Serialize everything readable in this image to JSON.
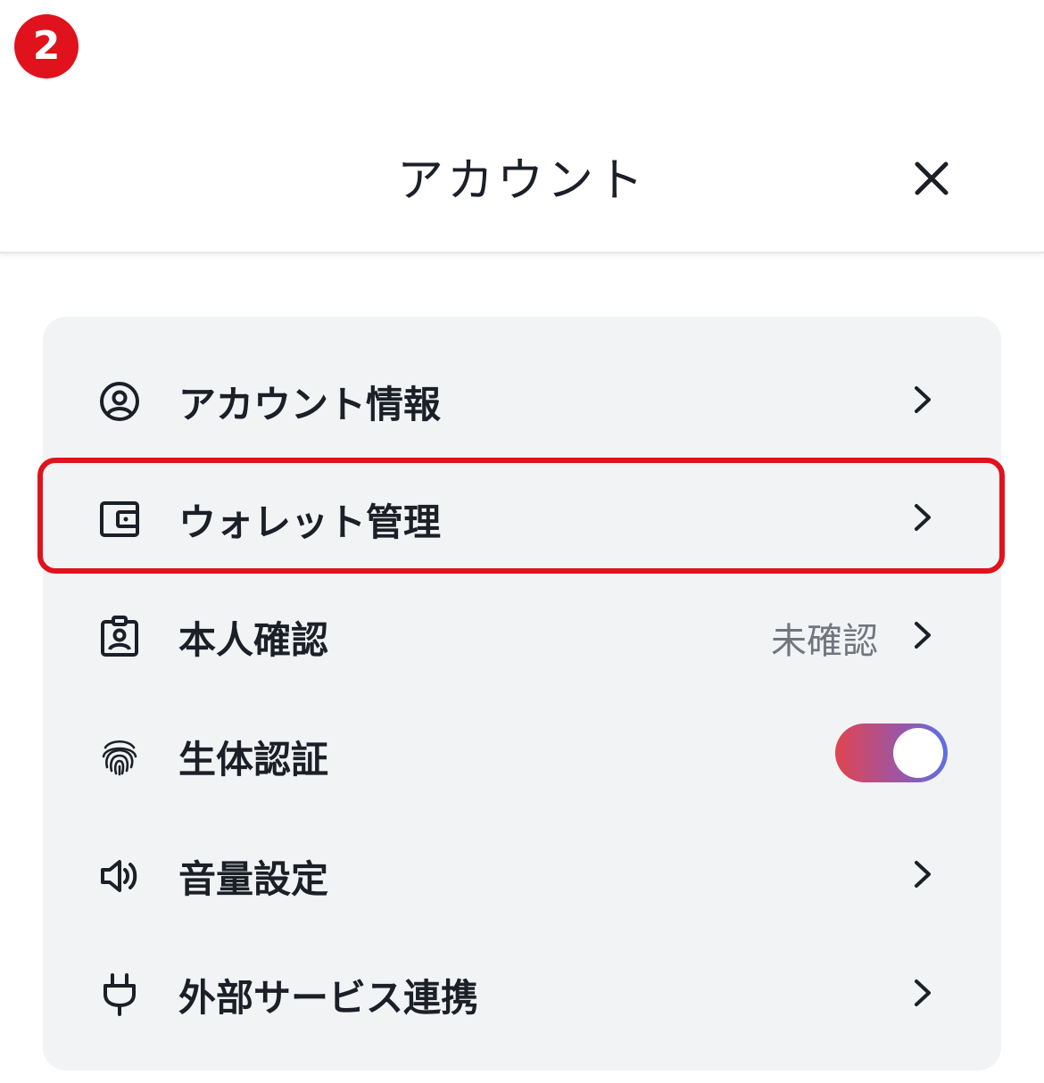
{
  "step_badge": "2",
  "header": {
    "title": "アカウント",
    "close_icon": "close-icon"
  },
  "menu": {
    "items": [
      {
        "label": "アカウント情報",
        "icon": "user-circle-icon"
      },
      {
        "label": "ウォレット管理",
        "icon": "wallet-icon",
        "highlighted": true
      },
      {
        "label": "本人確認",
        "icon": "id-badge-icon",
        "status": "未確認"
      },
      {
        "label": "生体認証",
        "icon": "fingerprint-icon",
        "toggle_on": true
      },
      {
        "label": "音量設定",
        "icon": "speaker-icon"
      },
      {
        "label": "外部サービス連携",
        "icon": "plug-icon"
      }
    ]
  },
  "colors": {
    "accent_red": "#e0121c",
    "card_bg": "#f2f3f5",
    "text": "#1b1f27",
    "muted": "#70757e",
    "toggle_gradient": [
      "#e0454f",
      "#5c6fe6"
    ]
  }
}
